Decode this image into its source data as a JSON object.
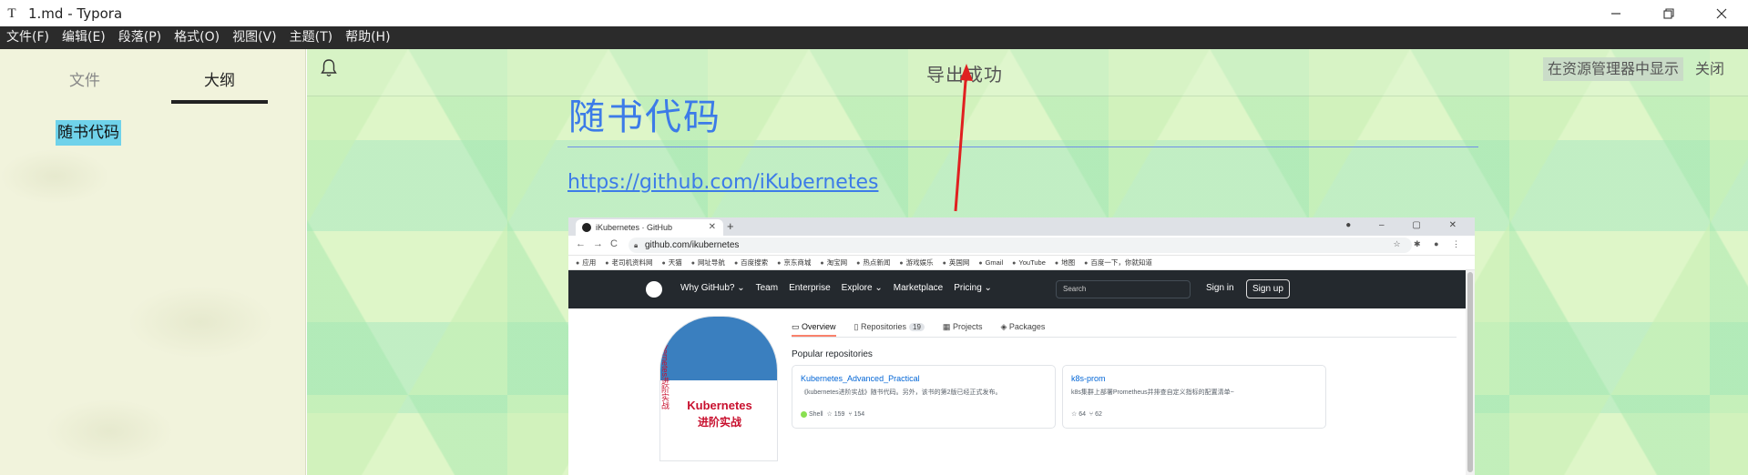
{
  "window": {
    "app_icon": "T",
    "title": "1.md - Typora",
    "controls": [
      "minimize-icon",
      "restore-icon",
      "close-icon"
    ]
  },
  "menu": [
    "文件(F)",
    "编辑(E)",
    "段落(P)",
    "格式(O)",
    "视图(V)",
    "主题(T)",
    "帮助(H)"
  ],
  "sidebar": {
    "tab_files": "文件",
    "tab_outline": "大纲",
    "active_tab": "大纲",
    "outline_items": [
      "随书代码"
    ]
  },
  "notification": {
    "message": "导出成功",
    "show_in_explorer": "在资源管理器中显示",
    "close": "关闭"
  },
  "document": {
    "heading": "随书代码",
    "link": "https://github.com/iKubernetes"
  },
  "embedded_screenshot": {
    "tab_title": "iKubernetes · GitHub",
    "url": "github.com/ikubernetes",
    "bookmarks": [
      "应用",
      "老司机资料网",
      "天猫",
      "网址导航",
      "百度搜索",
      "京东商城",
      "淘宝网",
      "热点新闻",
      "游戏娱乐",
      "英国网",
      "Gmail",
      "YouTube",
      "地图",
      "百度一下，你就知道"
    ],
    "gh_nav": [
      "Why GitHub? ⌄",
      "Team",
      "Enterprise",
      "Explore ⌄",
      "Marketplace",
      "Pricing ⌄"
    ],
    "search_placeholder": "Search",
    "sign_in": "Sign in",
    "sign_up": "Sign up",
    "profile_tabs": {
      "overview": "Overview",
      "repositories": "Repositories",
      "repositories_count": "19",
      "projects": "Projects",
      "packages": "Packages"
    },
    "popular_title": "Popular repositories",
    "book": {
      "title1": "Kubernetes",
      "title2": "进阶实战",
      "spine": "Kubernetes进阶实战"
    },
    "repos": [
      {
        "name": "Kubernetes_Advanced_Practical",
        "desc": "《kubernetes进阶实战》随书代码。另外，该书的第2版已经正式发布。",
        "lang": "Shell",
        "stars": "159",
        "forks": "154"
      },
      {
        "name": "k8s-prom",
        "desc": "k8s集群上部署Prometheus并排查自定义指标的配置清单~",
        "lang": "",
        "stars": "64",
        "forks": "62"
      }
    ]
  },
  "colors": {
    "menubar_bg": "#2b2b2b",
    "heading": "#3c7be8",
    "outline_highlight": "#6fd2ea",
    "arrow": "#e02020"
  }
}
